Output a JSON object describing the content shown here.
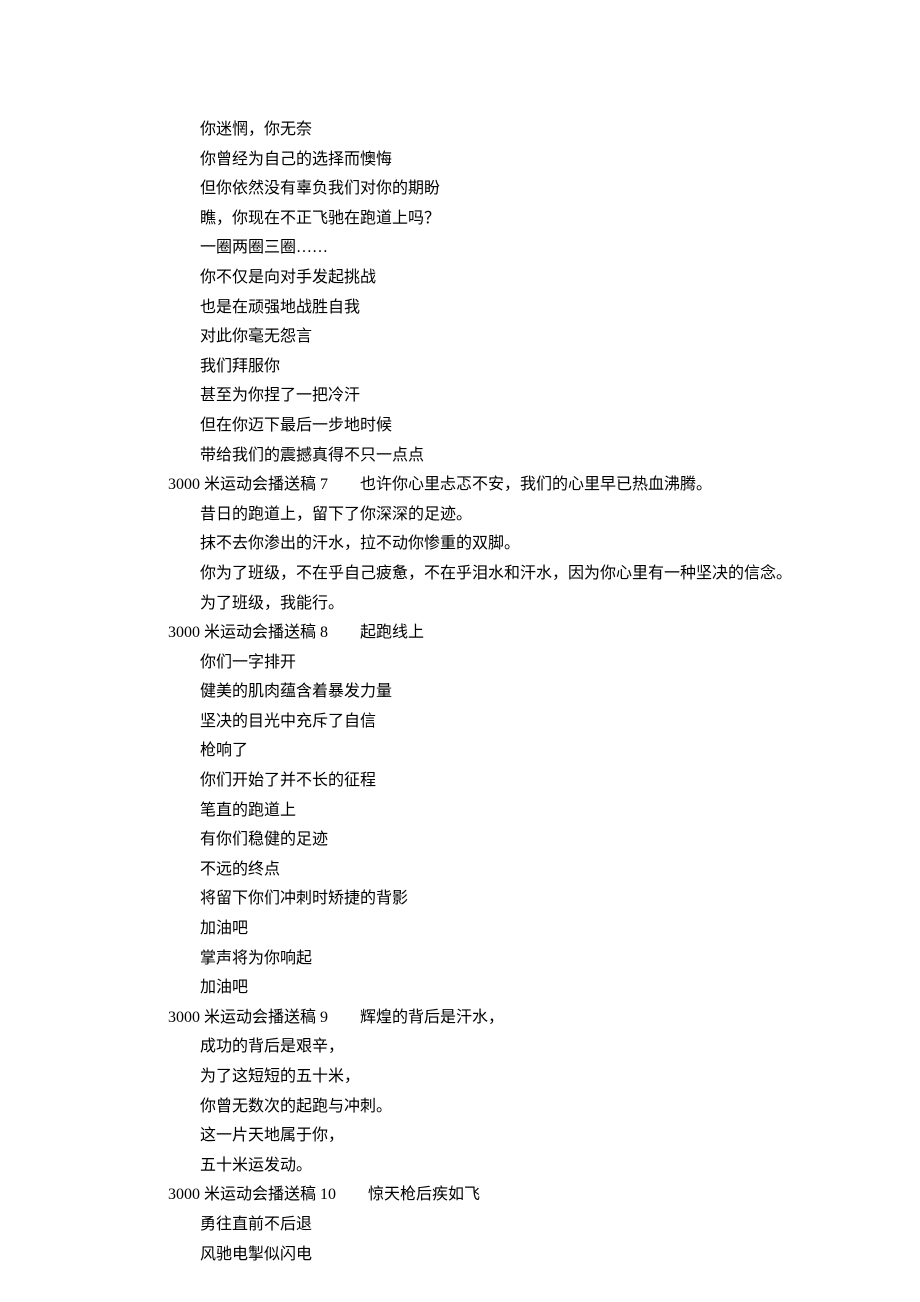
{
  "block_a": [
    "你迷惘，你无奈",
    "你曾经为自己的选择而懊悔",
    "但你依然没有辜负我们对你的期盼",
    "瞧，你现在不正飞驰在跑道上吗？",
    "一圈两圈三圈……",
    "你不仅是向对手发起挑战",
    "也是在顽强地战胜自我",
    "对此你毫无怨言",
    "我们拜服你",
    "甚至为你捏了一把冷汗",
    "但在你迈下最后一步地时候",
    "带给我们的震撼真得不只一点点"
  ],
  "section7": {
    "label": "3000 米运动会播送稿 7",
    "lead": "也许你心里忐忑不安，我们的心里早已热血沸腾。",
    "lines": [
      "昔日的跑道上，留下了你深深的足迹。",
      "抹不去你渗出的汗水，拉不动你惨重的双脚。",
      "你为了班级，不在乎自己疲惫，不在乎泪水和汗水，因为你心里有一种坚决的信念。",
      "为了班级，我能行。"
    ]
  },
  "section8": {
    "label": "3000 米运动会播送稿 8",
    "lead": "起跑线上",
    "lines": [
      "你们一字排开",
      "健美的肌肉蕴含着暴发力量",
      "坚决的目光中充斥了自信",
      "枪响了",
      "你们开始了并不长的征程",
      "笔直的跑道上",
      "有你们稳健的足迹",
      "不远的终点",
      "将留下你们冲刺时矫捷的背影",
      "加油吧",
      "掌声将为你响起",
      "加油吧"
    ]
  },
  "section9": {
    "label": "3000 米运动会播送稿 9",
    "lead": "辉煌的背后是汗水，",
    "lines": [
      "成功的背后是艰辛，",
      "为了这短短的五十米，",
      "你曾无数次的起跑与冲刺。",
      "这一片天地属于你，",
      "五十米运发动。"
    ]
  },
  "section10": {
    "label": "3000 米运动会播送稿 10",
    "lead": "惊天枪后疾如飞",
    "lines": [
      "勇往直前不后退",
      "风驰电掣似闪电"
    ]
  }
}
